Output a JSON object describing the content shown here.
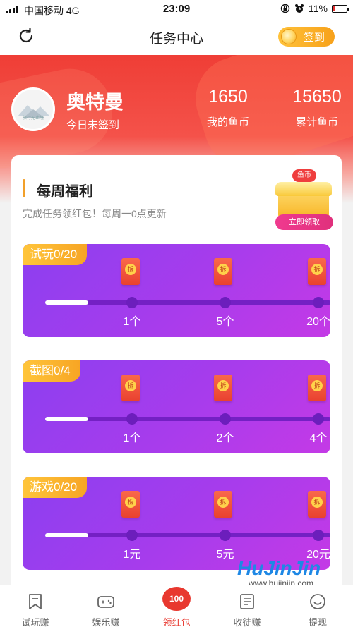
{
  "status_bar": {
    "carrier": "中国移动 4G",
    "time": "23:09",
    "battery": "11%",
    "battery_level": 0.11
  },
  "nav": {
    "title": "任务中心",
    "sign_in_label": "签到"
  },
  "profile": {
    "avatar_caption": "旅行无止境",
    "name": "奥特曼",
    "sign_status": "今日未签到"
  },
  "stats": [
    {
      "value": "1650",
      "label": "我的鱼币"
    },
    {
      "value": "15650",
      "label": "累计鱼币"
    }
  ],
  "weekly": {
    "title": "每周福利",
    "subtitle": "完成任务领红包！每周一0点更新",
    "chest_tag": "鱼币",
    "chest_button": "立即领取"
  },
  "tasks": [
    {
      "title": "试玩0/20",
      "progress": 0.15,
      "milestones": [
        "1个",
        "5个",
        "20个"
      ],
      "packet_glyph": "拆"
    },
    {
      "title": "截图0/4",
      "progress": 0.15,
      "milestones": [
        "1个",
        "2个",
        "4个"
      ],
      "packet_glyph": "拆"
    },
    {
      "title": "游戏0/20",
      "progress": 0.15,
      "milestones": [
        "1元",
        "5元",
        "20元"
      ],
      "packet_glyph": "拆"
    }
  ],
  "tabs": [
    {
      "label": "试玩赚",
      "icon": "bookmark-icon"
    },
    {
      "label": "娱乐赚",
      "icon": "gamepad-icon"
    },
    {
      "label": "领红包",
      "icon": "red-packet-icon",
      "badge": "100",
      "active": true
    },
    {
      "label": "收徒赚",
      "icon": "document-icon"
    },
    {
      "label": "提现",
      "icon": "smile-icon"
    }
  ],
  "watermark": {
    "title": "HuJinJin",
    "url": "www.hujinjin.com"
  }
}
